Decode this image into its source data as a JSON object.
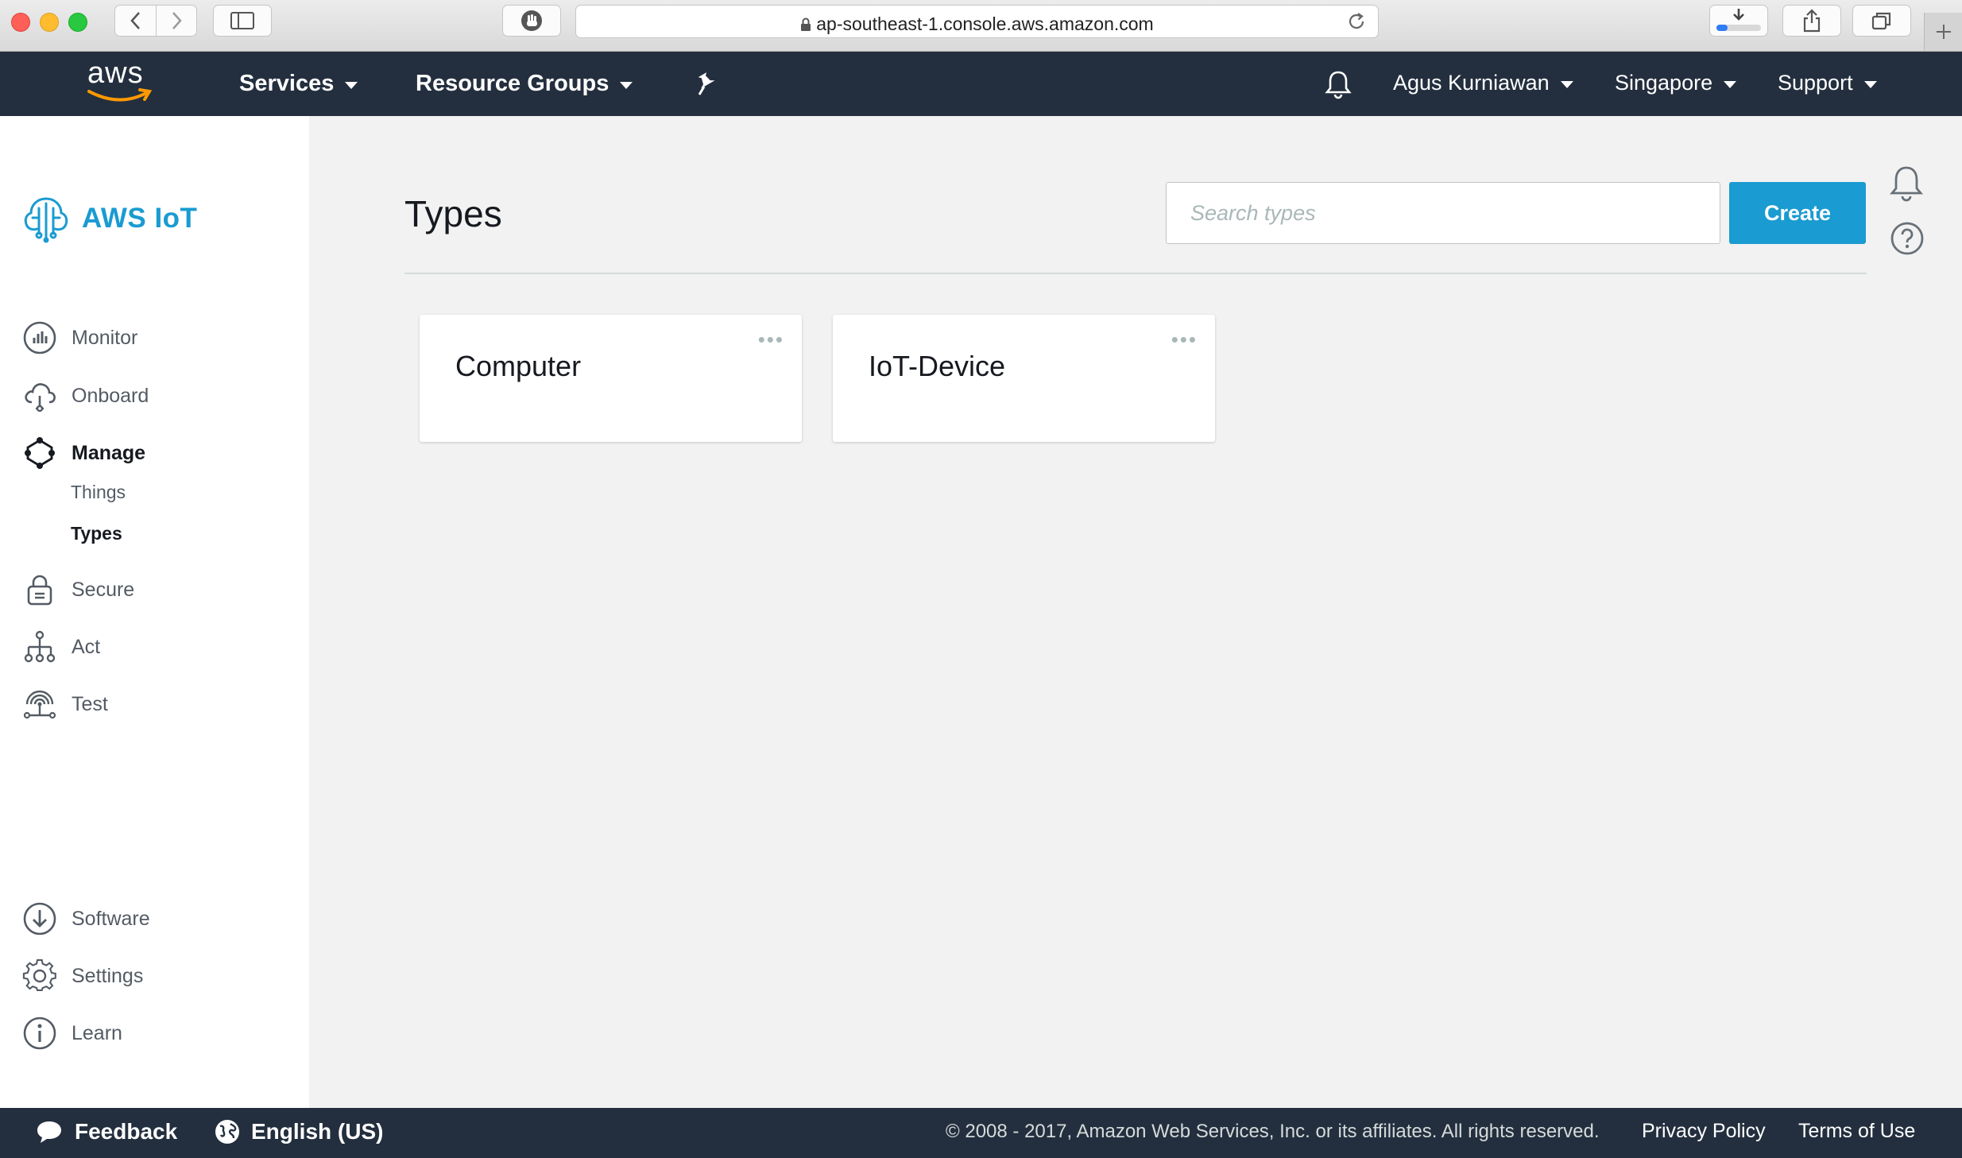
{
  "browser": {
    "url": "ap-southeast-1.console.aws.amazon.com",
    "download_progress": 0.25
  },
  "topnav": {
    "logo_text": "aws",
    "services_label": "Services",
    "resource_groups_label": "Resource Groups",
    "user_label": "Agus Kurniawan",
    "region_label": "Singapore",
    "support_label": "Support"
  },
  "sidebar": {
    "brand": "AWS IoT",
    "items": [
      {
        "label": "Monitor",
        "icon": "bar-chart-icon"
      },
      {
        "label": "Onboard",
        "icon": "cloud-icon"
      },
      {
        "label": "Manage",
        "icon": "manage-icon",
        "active": true
      },
      {
        "label": "Secure",
        "icon": "lock-icon"
      },
      {
        "label": "Act",
        "icon": "hierarchy-icon"
      },
      {
        "label": "Test",
        "icon": "broadcast-icon"
      }
    ],
    "manage_subitems": [
      {
        "label": "Things"
      },
      {
        "label": "Types",
        "active": true
      }
    ],
    "bottom_items": [
      {
        "label": "Software",
        "icon": "download-icon"
      },
      {
        "label": "Settings",
        "icon": "gear-icon"
      },
      {
        "label": "Learn",
        "icon": "info-icon"
      }
    ]
  },
  "main": {
    "title": "Types",
    "search_placeholder": "Search types",
    "create_label": "Create",
    "cards": [
      {
        "title": "Computer",
        "menu": "•••"
      },
      {
        "title": "IoT-Device",
        "menu": "•••"
      }
    ]
  },
  "footer": {
    "feedback_label": "Feedback",
    "language_label": "English (US)",
    "copyright": "© 2008 - 2017, Amazon Web Services, Inc. or its affiliates. All rights reserved.",
    "privacy_label": "Privacy Policy",
    "terms_label": "Terms of Use"
  },
  "colors": {
    "nav_bg": "#232f3e",
    "accent": "#1a9bd1",
    "aws_orange": "#ff9900",
    "iot_teal": "#1a9bd1"
  }
}
